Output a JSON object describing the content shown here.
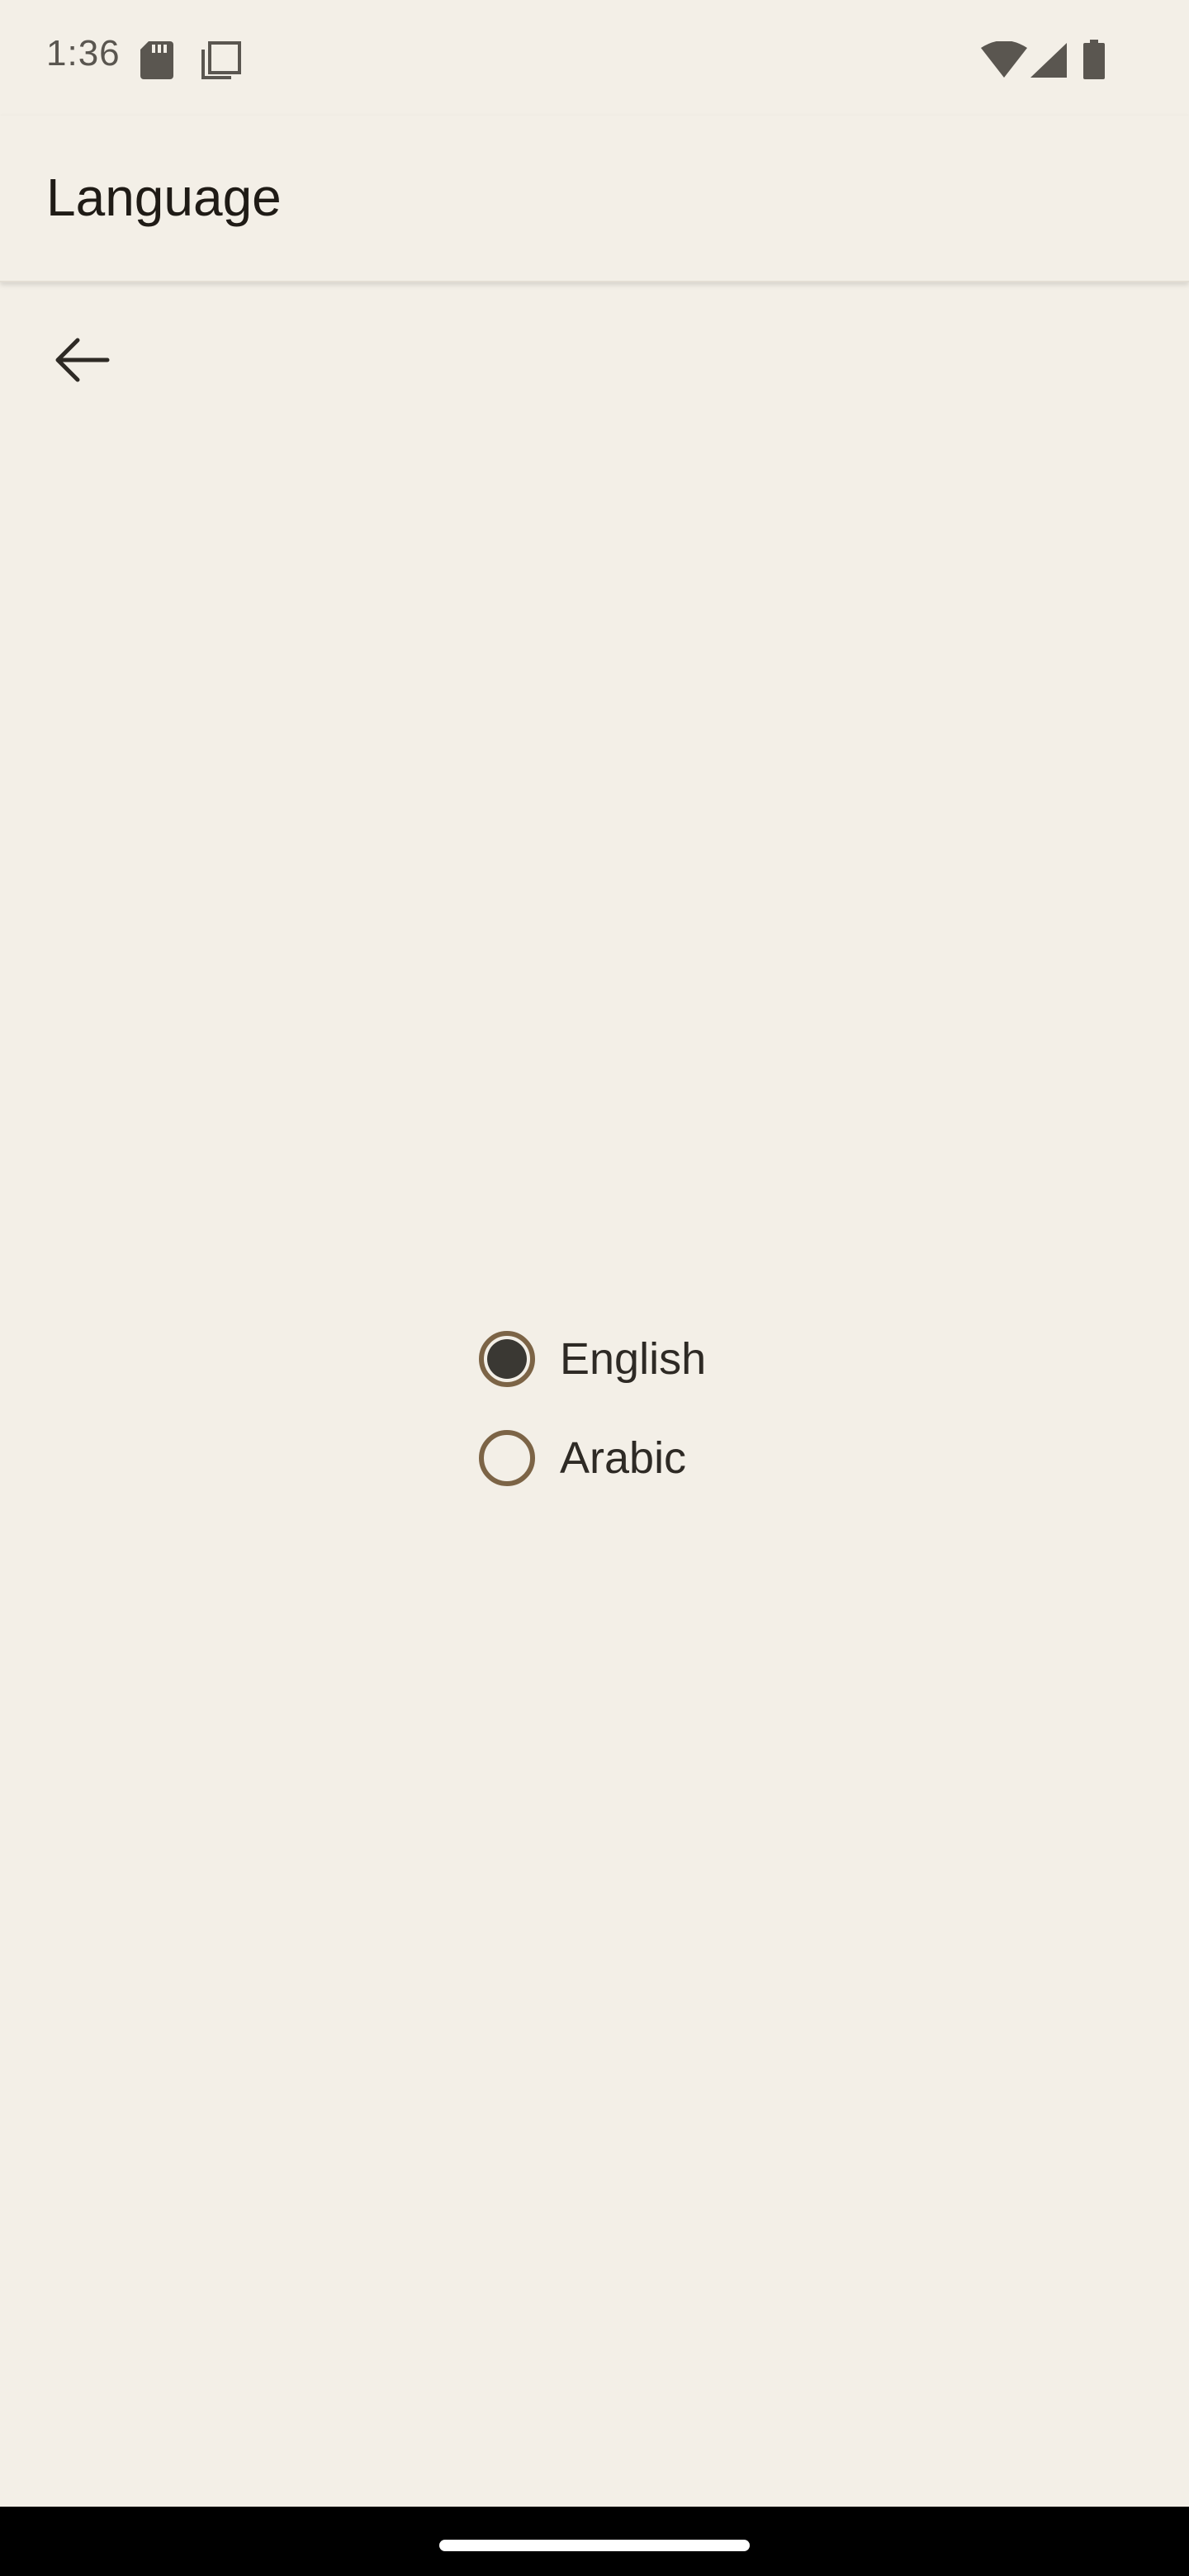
{
  "status_bar": {
    "time": "1:36",
    "icons": [
      "sd-card-icon",
      "screenshot-icon",
      "wifi-icon",
      "signal-icon",
      "battery-icon"
    ]
  },
  "app_bar": {
    "title": "Language",
    "back_icon": "arrow-back-icon"
  },
  "language_options": {
    "selected": "English",
    "items": [
      {
        "label": "English",
        "checked": true
      },
      {
        "label": "Arabic",
        "checked": false
      }
    ]
  },
  "colors": {
    "background": "#f3efe7",
    "radio_outline": "#7c6446",
    "radio_fill": "#3a3833",
    "text": "#2e2a25"
  }
}
